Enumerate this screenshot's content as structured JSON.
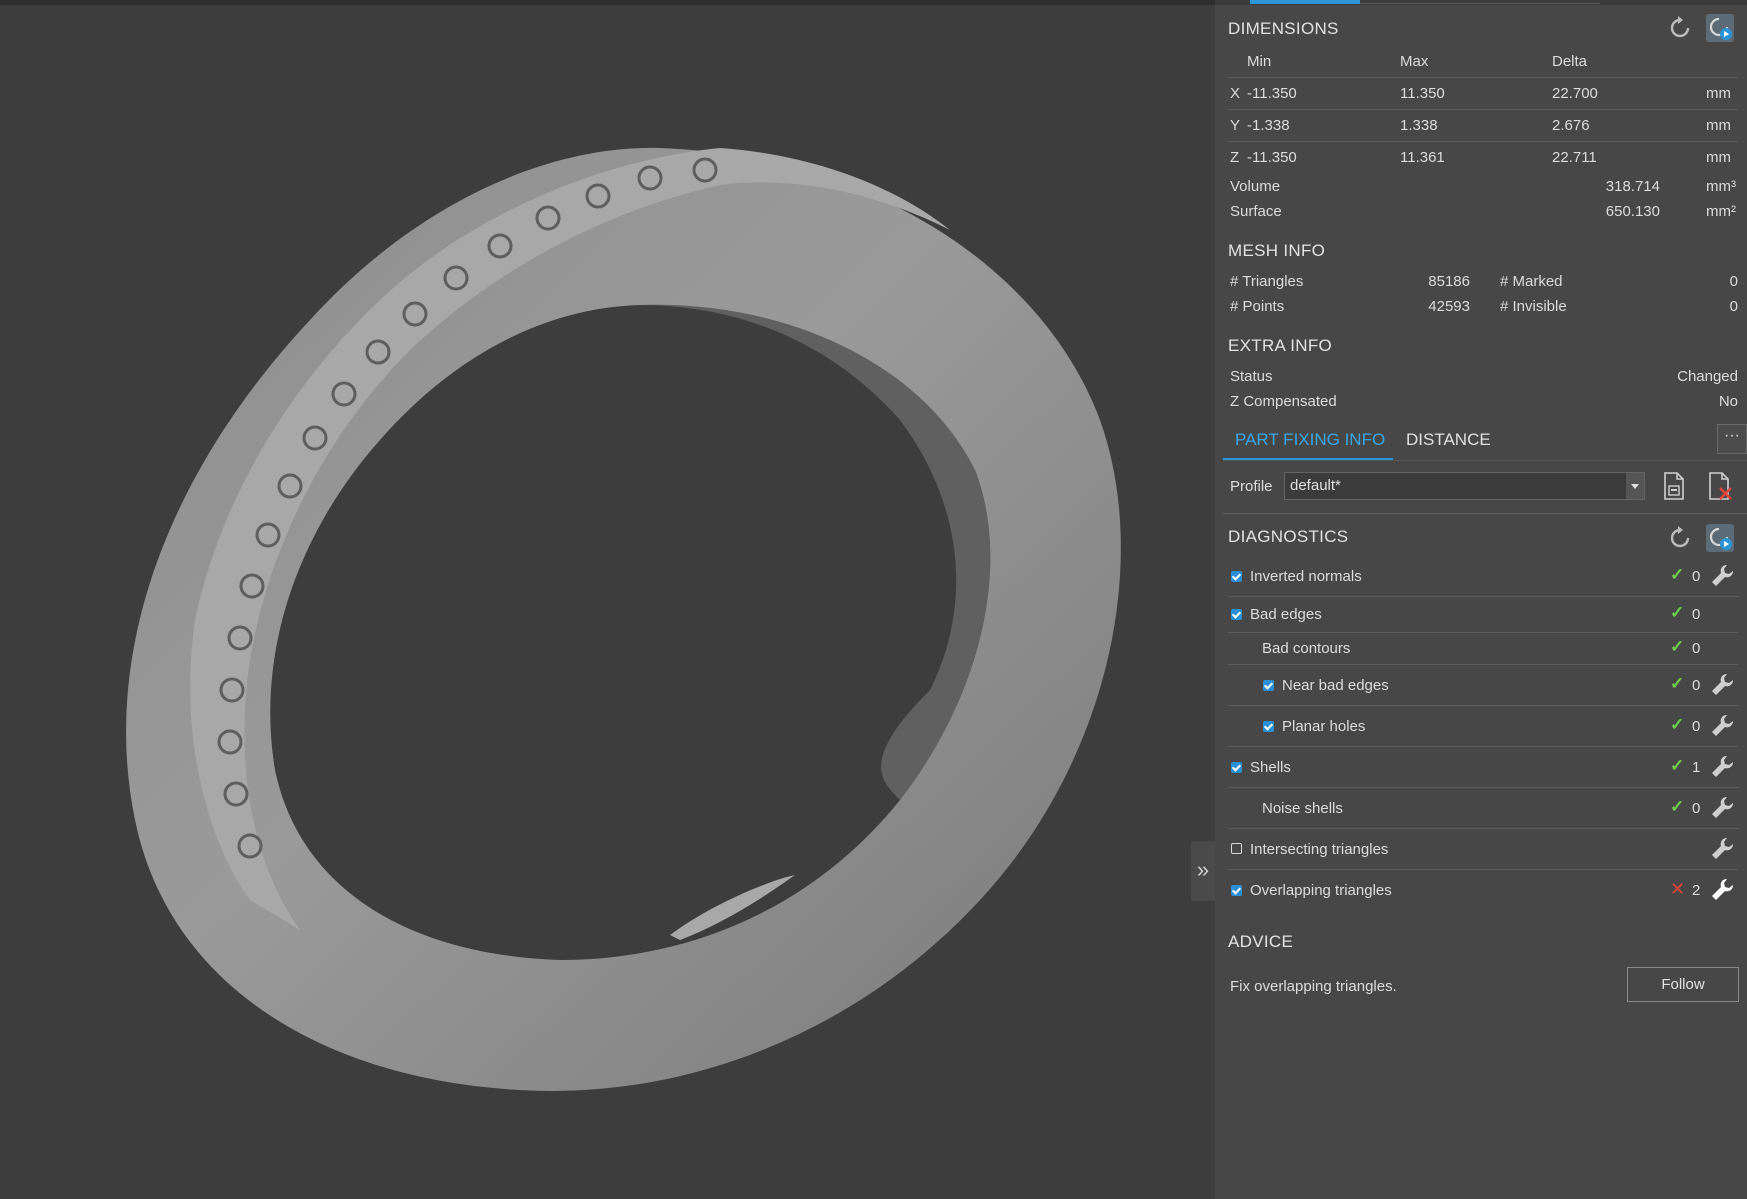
{
  "dimensions": {
    "title": "DIMENSIONS",
    "headers": {
      "min": "Min",
      "max": "Max",
      "delta": "Delta"
    },
    "rows": [
      {
        "axis": "X",
        "min": "-11.350",
        "max": "11.350",
        "delta": "22.700",
        "unit": "mm"
      },
      {
        "axis": "Y",
        "min": "-1.338",
        "max": "1.338",
        "delta": "2.676",
        "unit": "mm"
      },
      {
        "axis": "Z",
        "min": "-11.350",
        "max": "11.361",
        "delta": "22.711",
        "unit": "mm"
      }
    ],
    "volume": {
      "label": "Volume",
      "value": "318.714",
      "unit": "mm³"
    },
    "surface": {
      "label": "Surface",
      "value": "650.130",
      "unit": "mm²"
    }
  },
  "mesh_info": {
    "title": "MESH INFO",
    "triangles_label": "# Triangles",
    "triangles": "85186",
    "marked_label": "# Marked",
    "marked": "0",
    "points_label": "# Points",
    "points": "42593",
    "invisible_label": "# Invisible",
    "invisible": "0"
  },
  "extra_info": {
    "title": "EXTRA INFO",
    "status_label": "Status",
    "status": "Changed",
    "zcomp_label": "Z Compensated",
    "zcomp": "No"
  },
  "tabs": {
    "part_fixing": "PART FIXING INFO",
    "distance": "DISTANCE",
    "more": "···"
  },
  "profile": {
    "label": "Profile",
    "value": "default*"
  },
  "diagnostics": {
    "title": "DIAGNOSTICS",
    "items": [
      {
        "label": "Inverted normals",
        "count": "0",
        "checked": true,
        "status": "ok",
        "fix": true
      },
      {
        "label": "Bad edges",
        "count": "0",
        "checked": true,
        "status": "ok",
        "fix": false
      },
      {
        "label": "Bad contours",
        "count": "0",
        "checked": null,
        "status": "ok",
        "fix": false
      },
      {
        "label": "Near bad edges",
        "count": "0",
        "checked": true,
        "status": "ok",
        "fix": true
      },
      {
        "label": "Planar holes",
        "count": "0",
        "checked": true,
        "status": "ok",
        "fix": true
      },
      {
        "label": "Shells",
        "count": "1",
        "checked": true,
        "status": "ok",
        "fix": true
      },
      {
        "label": "Noise shells",
        "count": "0",
        "checked": null,
        "status": "ok",
        "fix": true
      },
      {
        "label": "Intersecting triangles",
        "count": "",
        "checked": false,
        "status": "none",
        "fix": true
      },
      {
        "label": "Overlapping triangles",
        "count": "2",
        "checked": true,
        "status": "error",
        "fix": true
      }
    ]
  },
  "advice": {
    "title": "ADVICE",
    "text": "Fix overlapping triangles.",
    "button": "Follow"
  },
  "colors": {
    "accent": "#2c95d8",
    "ok": "#6fcf4a",
    "error": "#e2453a",
    "panel": "#474747",
    "viewport": "#3d3d3d"
  },
  "viewport": {
    "collapse_glyph": "»",
    "object": "3d-ring-model"
  }
}
